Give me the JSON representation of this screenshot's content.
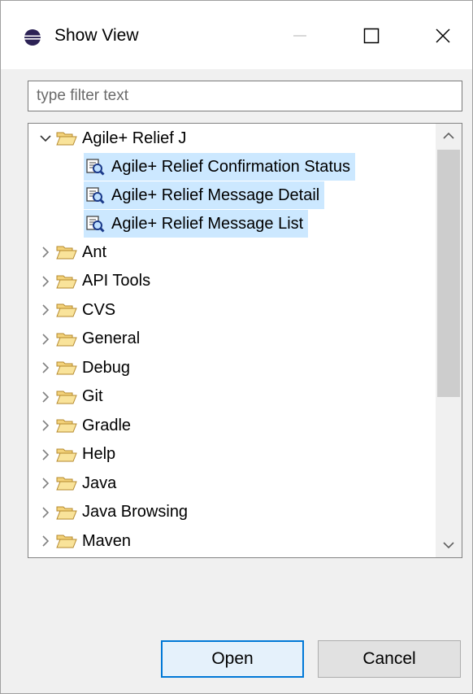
{
  "window": {
    "title": "Show View"
  },
  "filter": {
    "placeholder": "type filter text",
    "value": ""
  },
  "tree": {
    "expanded_group": {
      "label": "Agile+ Relief J",
      "children": [
        "Agile+ Relief Confirmation Status",
        "Agile+ Relief Message Detail",
        "Agile+ Relief Message List"
      ]
    },
    "groups": [
      "Ant",
      "API Tools",
      "CVS",
      "General",
      "Debug",
      "Git",
      "Gradle",
      "Help",
      "Java",
      "Java Browsing",
      "Maven"
    ]
  },
  "buttons": {
    "open": "Open",
    "cancel": "Cancel"
  },
  "icons": {
    "app": "eclipse-icon",
    "folder": "folder-open-icon",
    "view": "view-search-icon"
  },
  "colors": {
    "selection": "#cce8ff",
    "default_button_border": "#0078d7"
  }
}
